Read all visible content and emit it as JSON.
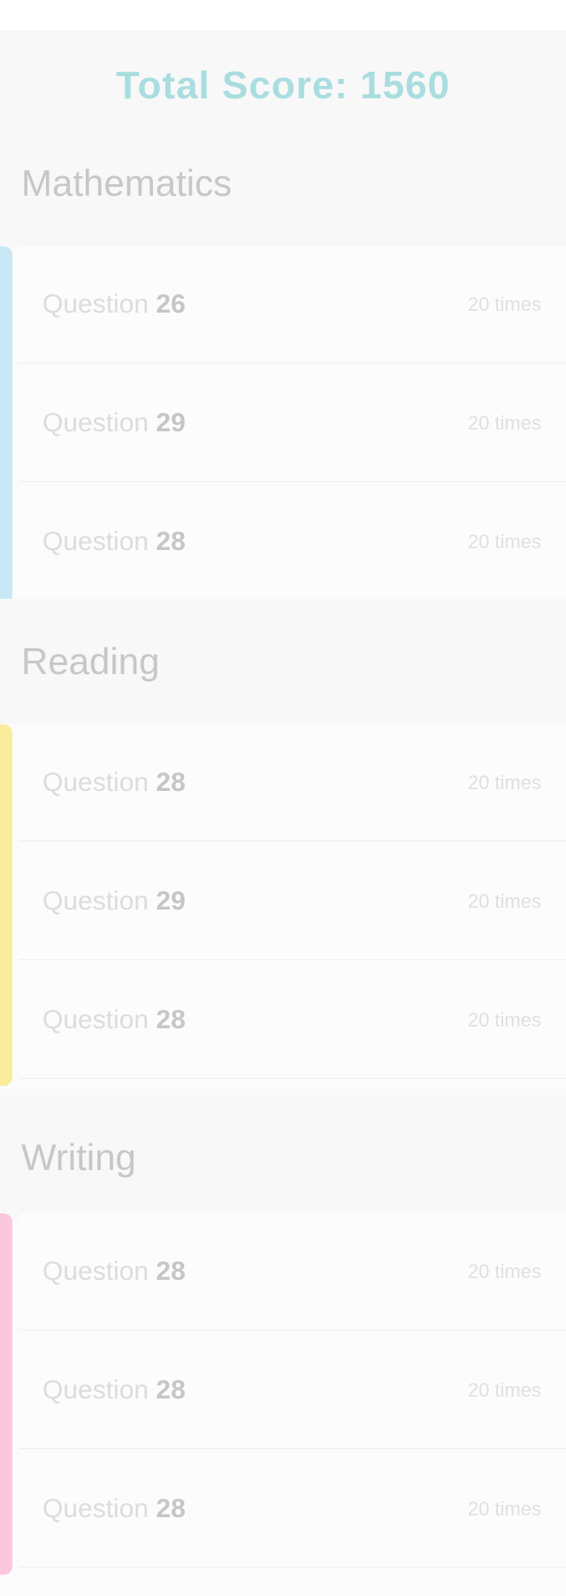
{
  "header": {
    "score_text": "Total Score: 1560"
  },
  "sections": [
    {
      "title": "Mathematics",
      "accent_color": "#c9e8f6",
      "questions": [
        {
          "prefix": "Question",
          "number": "26",
          "meta": "20 times"
        },
        {
          "prefix": "Question",
          "number": "29",
          "meta": "20 times"
        },
        {
          "prefix": "Question",
          "number": "28",
          "meta": "20 times"
        }
      ]
    },
    {
      "title": "Reading",
      "accent_color": "#f9ec9b",
      "questions": [
        {
          "prefix": "Question",
          "number": "28",
          "meta": "20 times"
        },
        {
          "prefix": "Question",
          "number": "29",
          "meta": "20 times"
        },
        {
          "prefix": "Question",
          "number": "28",
          "meta": "20 times"
        }
      ]
    },
    {
      "title": "Writing",
      "accent_color": "#fbc7dc",
      "questions": [
        {
          "prefix": "Question",
          "number": "28",
          "meta": "20 times"
        },
        {
          "prefix": "Question",
          "number": "28",
          "meta": "20 times"
        },
        {
          "prefix": "Question",
          "number": "28",
          "meta": "20 times"
        }
      ]
    }
  ]
}
